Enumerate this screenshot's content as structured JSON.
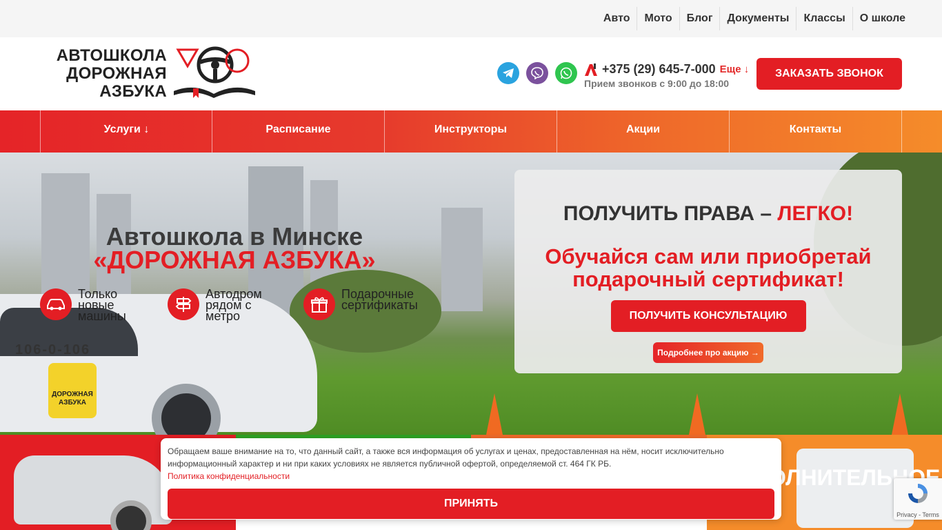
{
  "top_nav": [
    "Авто",
    "Мото",
    "Блог",
    "Документы",
    "Классы",
    "О школе"
  ],
  "logo": {
    "line1": "АВТОШКОЛА",
    "line2": "ДОРОЖНАЯ",
    "line3": "АЗБУКА"
  },
  "contacts": {
    "phone": "+375 (29) 645-7-000",
    "more": "Еще ↓",
    "hours": "Прием звонков с 9:00 до 18:00",
    "call_button": "ЗАКАЗАТЬ ЗВОНОК"
  },
  "main_nav": [
    "Услуги  ↓",
    "Расписание",
    "Инструкторы",
    "Акции",
    "Контакты"
  ],
  "hero": {
    "title_line1": "Автошкола в Минске",
    "title_line2": "«ДОРОЖНАЯ АЗБУКА»",
    "car_plate": "106-0-106",
    "car_badge": "ДОРОЖНАЯ АЗБУКА",
    "features": [
      {
        "text": "Только новые машины",
        "icon": "car-icon"
      },
      {
        "text": "Автодром рядом с метро",
        "icon": "signpost-icon"
      },
      {
        "text": "Подарочные сертификаты",
        "icon": "gift-icon"
      }
    ]
  },
  "promo": {
    "headline": "ПОЛУЧИТЬ ПРАВА –",
    "headline_accent": "ЛЕГКО!",
    "subline": "Обучайся сам или приобретай подарочный сертификат!",
    "consult_button": "ПОЛУЧИТЬ КОНСУЛЬТАЦИЮ",
    "more_link": "Подробнее про акцию →"
  },
  "categories": {
    "cat4_title": "ОЛНИТЕЛЬНОЕ"
  },
  "cookie": {
    "text": "Обращаем ваше внимание на то, что данный сайт, а также вся информация об услугах и ценах, предоставленная на нём, носит исключительно информационный характер и ни при каких условиях не является публичной офертой, определяемой ст. 464 ГК РБ.",
    "privacy_link": "Политика конфиденциальности",
    "accept_button": "ПРИНЯТЬ"
  },
  "recaptcha": {
    "text": "Privacy - Terms"
  },
  "colors": {
    "brand_red": "#e31e24",
    "orange": "#f58c2a",
    "green": "#2ea324"
  }
}
